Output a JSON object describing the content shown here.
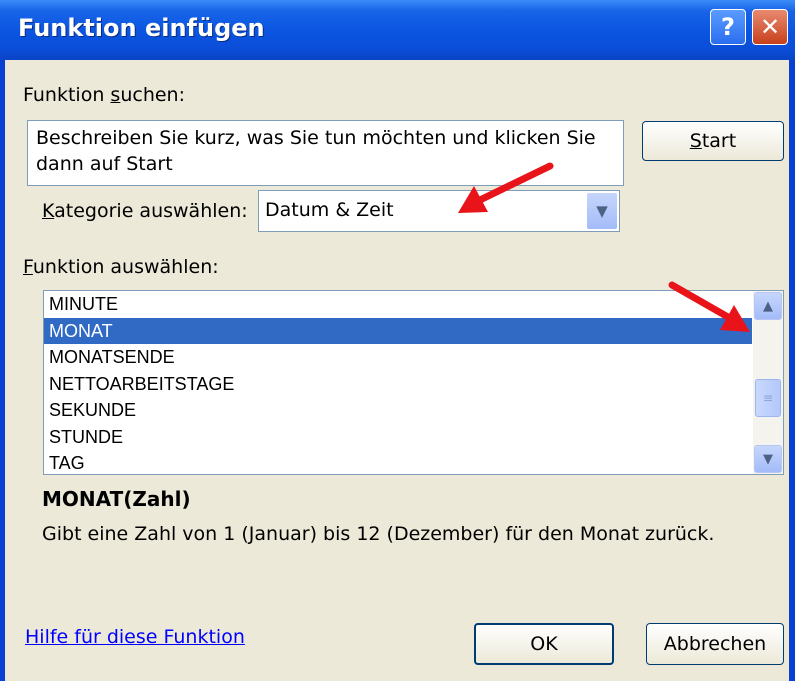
{
  "window": {
    "title": "Funktion einfügen",
    "help_glyph": "?",
    "close_glyph": "✕"
  },
  "search": {
    "label_pre": "Funktion ",
    "label_key": "s",
    "label_post": "uchen:",
    "value": "Beschreiben Sie kurz, was Sie tun möchten und klicken Sie dann auf Start",
    "start_pre": "",
    "start_key": "S",
    "start_post": "tart"
  },
  "category": {
    "label_key": "K",
    "label_post": "ategorie auswählen:",
    "selected": "Datum & Zeit"
  },
  "function_list": {
    "label_key": "F",
    "label_post": "unktion auswählen:",
    "items": [
      "MINUTE",
      "MONAT",
      "MONATSENDE",
      "NETTOARBEITSTAGE",
      "SEKUNDE",
      "STUNDE",
      "TAG"
    ],
    "selected": "MONAT"
  },
  "details": {
    "signature": "MONAT(Zahl)",
    "description": "Gibt eine Zahl von 1 (Januar) bis 12 (Dezember) für den Monat zurück."
  },
  "footer": {
    "help_link": "Hilfe für diese Funktion",
    "ok_label": "OK",
    "cancel_label": "Abbrechen"
  },
  "colors": {
    "titlebar": "#0a54e0",
    "selection": "#316ac5",
    "annotation_arrow": "#e8141a",
    "dialog_bg": "#ece9d8"
  },
  "icons": {
    "dropdown": "chevron-down-icon",
    "scroll_up": "chevron-up-icon",
    "scroll_down": "chevron-down-icon"
  }
}
